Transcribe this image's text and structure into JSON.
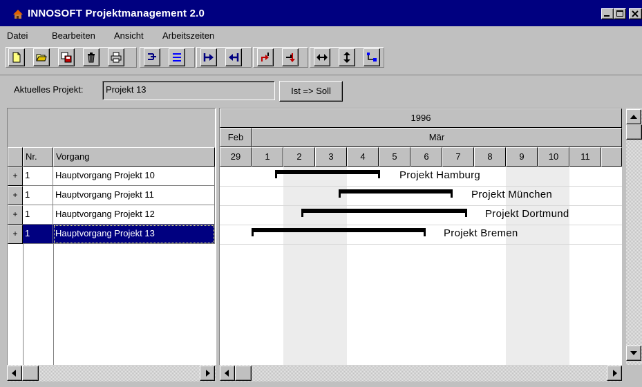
{
  "window": {
    "title": "INNOSOFT Projektmanagement 2.0"
  },
  "menu": [
    "Datei",
    "Bearbeiten",
    "Ansicht",
    "Arbeitszeiten"
  ],
  "project": {
    "label": "Aktuelles Projekt:",
    "value": "Projekt 13",
    "button": "Ist => Soll"
  },
  "grid": {
    "headers": {
      "nr": "Nr.",
      "vorgang": "Vorgang"
    },
    "rows": [
      {
        "expand": "+",
        "nr": "1",
        "vorgang": "Hauptvorgang Projekt 10"
      },
      {
        "expand": "+",
        "nr": "1",
        "vorgang": "Hauptvorgang Projekt 11"
      },
      {
        "expand": "+",
        "nr": "1",
        "vorgang": "Hauptvorgang Projekt 12"
      },
      {
        "expand": "+",
        "nr": "1",
        "vorgang": "Hauptvorgang Projekt 13"
      }
    ]
  },
  "gantt": {
    "year": "1996",
    "months": [
      "Feb",
      "Mär"
    ],
    "days": [
      "29",
      "1",
      "2",
      "3",
      "4",
      "5",
      "6",
      "7",
      "8",
      "9",
      "10",
      "11"
    ],
    "bars": [
      {
        "label": "Projekt Hamburg"
      },
      {
        "label": "Projekt München"
      },
      {
        "label": "Projekt Dortmund"
      },
      {
        "label": "Projekt Bremen"
      }
    ]
  }
}
